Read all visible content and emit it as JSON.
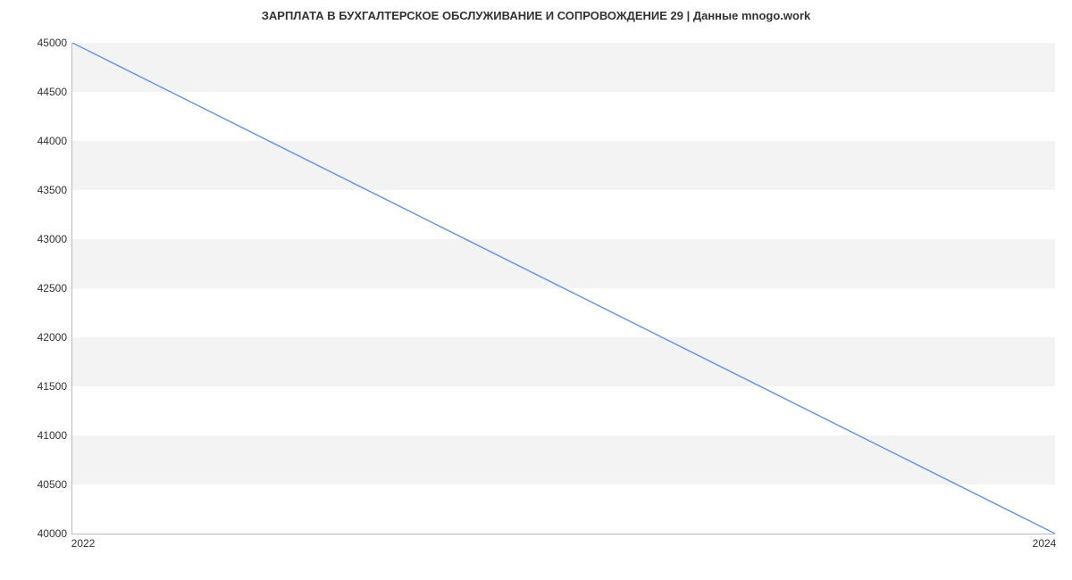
{
  "chart_data": {
    "type": "line",
    "title": "ЗАРПЛАТА В БУХГАЛТЕРСКОЕ ОБСЛУЖИВАНИЕ И СОПРОВОЖДЕНИЕ 29 | Данные mnogo.work",
    "xlabel": "",
    "ylabel": "",
    "x": [
      2022,
      2024
    ],
    "values": [
      45000,
      40000
    ],
    "x_ticks": [
      2022,
      2024
    ],
    "y_ticks": [
      40000,
      40500,
      41000,
      41500,
      42000,
      42500,
      43000,
      43500,
      44000,
      44500,
      45000
    ],
    "xlim": [
      2022,
      2024
    ],
    "ylim": [
      40000,
      45000
    ],
    "series_color": "#6f98de",
    "band_color": "#f3f3f3"
  }
}
